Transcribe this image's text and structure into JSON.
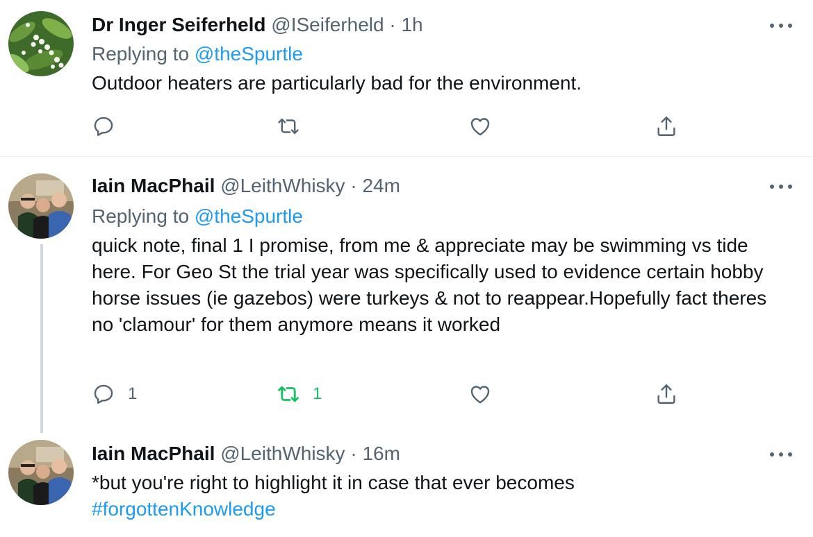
{
  "tweets": [
    {
      "name": "Dr Inger Seiferheld",
      "handle": "@ISeiferheld",
      "sep": "·",
      "time": "1h",
      "replying_prefix": "Replying to",
      "replying_to": "@theSpurtle",
      "text": "Outdoor heaters are particularly bad for the environment.",
      "reply_count": "",
      "retweet_count": "",
      "like_count": ""
    },
    {
      "name": "Iain MacPhail",
      "handle": "@LeithWhisky",
      "sep": "·",
      "time": "24m",
      "replying_prefix": "Replying to",
      "replying_to": "@theSpurtle",
      "text": "quick note, final 1 I promise, from me & appreciate may be swimming vs tide here. For Geo St the trial year was specifically used to evidence certain hobby horse issues (ie gazebos) were turkeys & not to reappear.Hopefully fact theres no 'clamour' for them anymore means it worked",
      "reply_count": "1",
      "retweet_count": "1",
      "like_count": ""
    },
    {
      "name": "Iain MacPhail",
      "handle": "@LeithWhisky",
      "sep": "·",
      "time": "16m",
      "text": "*but you're right to highlight it in case that ever becomes",
      "hashtag": "#forgottenKnowledge"
    }
  ],
  "icons": {
    "reply": "reply-icon",
    "retweet": "retweet-icon",
    "like": "heart-icon",
    "share": "share-icon",
    "more": "more-icon"
  },
  "colors": {
    "link": "#1d9bf0",
    "secondary": "#536471",
    "retweeted": "#17bf63"
  }
}
